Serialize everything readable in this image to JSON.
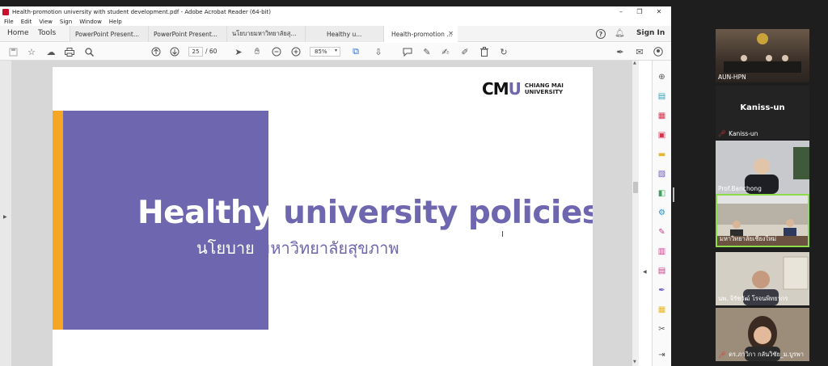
{
  "window": {
    "title": "Health-promotion university with student development.pdf - Adobe Acrobat Reader (64-bit)",
    "controls": {
      "minimize": "–",
      "maximize": "❐",
      "close": "✕"
    }
  },
  "menu": [
    "File",
    "Edit",
    "View",
    "Sign",
    "Window",
    "Help"
  ],
  "nav": {
    "home": "Home",
    "tools": "Tools",
    "sign_in": "Sign In"
  },
  "tabs": [
    {
      "label": "PowerPoint Present..."
    },
    {
      "label": "PowerPoint Present..."
    },
    {
      "label": "นโยบายมหาวิทยาลัยสุ..."
    },
    {
      "label": "Healthy u..."
    },
    {
      "label": "Health-promotion ...",
      "active": true
    }
  ],
  "toolbar": {
    "page_current": "25",
    "page_total": "/ 60",
    "zoom": "85%",
    "zoom_caret": "▾"
  },
  "slide": {
    "logo_mark_c": "C",
    "logo_mark_m": "M",
    "logo_mark_u": "U",
    "logo_line1": "CHIANG MAI",
    "logo_line2": "UNIVERSITY",
    "title_en_part1": "Healthy",
    "title_en_part2": " university policies",
    "title_th_part1": "นโยบาย",
    "title_th_part2": " มหาวิทยาลัยสุขภาพ",
    "accent_purple": "#6e66ae",
    "accent_orange": "#f5a623"
  },
  "participants": [
    {
      "name": "AUN-HPN",
      "video": true,
      "muted": false
    },
    {
      "name": "Kaniss-un",
      "display": "Kaniss-un",
      "video": false,
      "muted": true
    },
    {
      "name": "Prof.Banchong",
      "video": true,
      "muted": false
    },
    {
      "name": "มหาวิทยาลัยเชียงใหม่",
      "video": true,
      "muted": false,
      "active_speaker": true
    },
    {
      "name": "นพ. จิรัชวัฒ์ โรจนพิทยากร",
      "video": true,
      "muted": false
    },
    {
      "name": "ดร.ภาวิกา กลันวิชัย_ม.บูรพา",
      "video": true,
      "muted": true
    }
  ],
  "icons": {
    "mic_off": "🎤"
  }
}
